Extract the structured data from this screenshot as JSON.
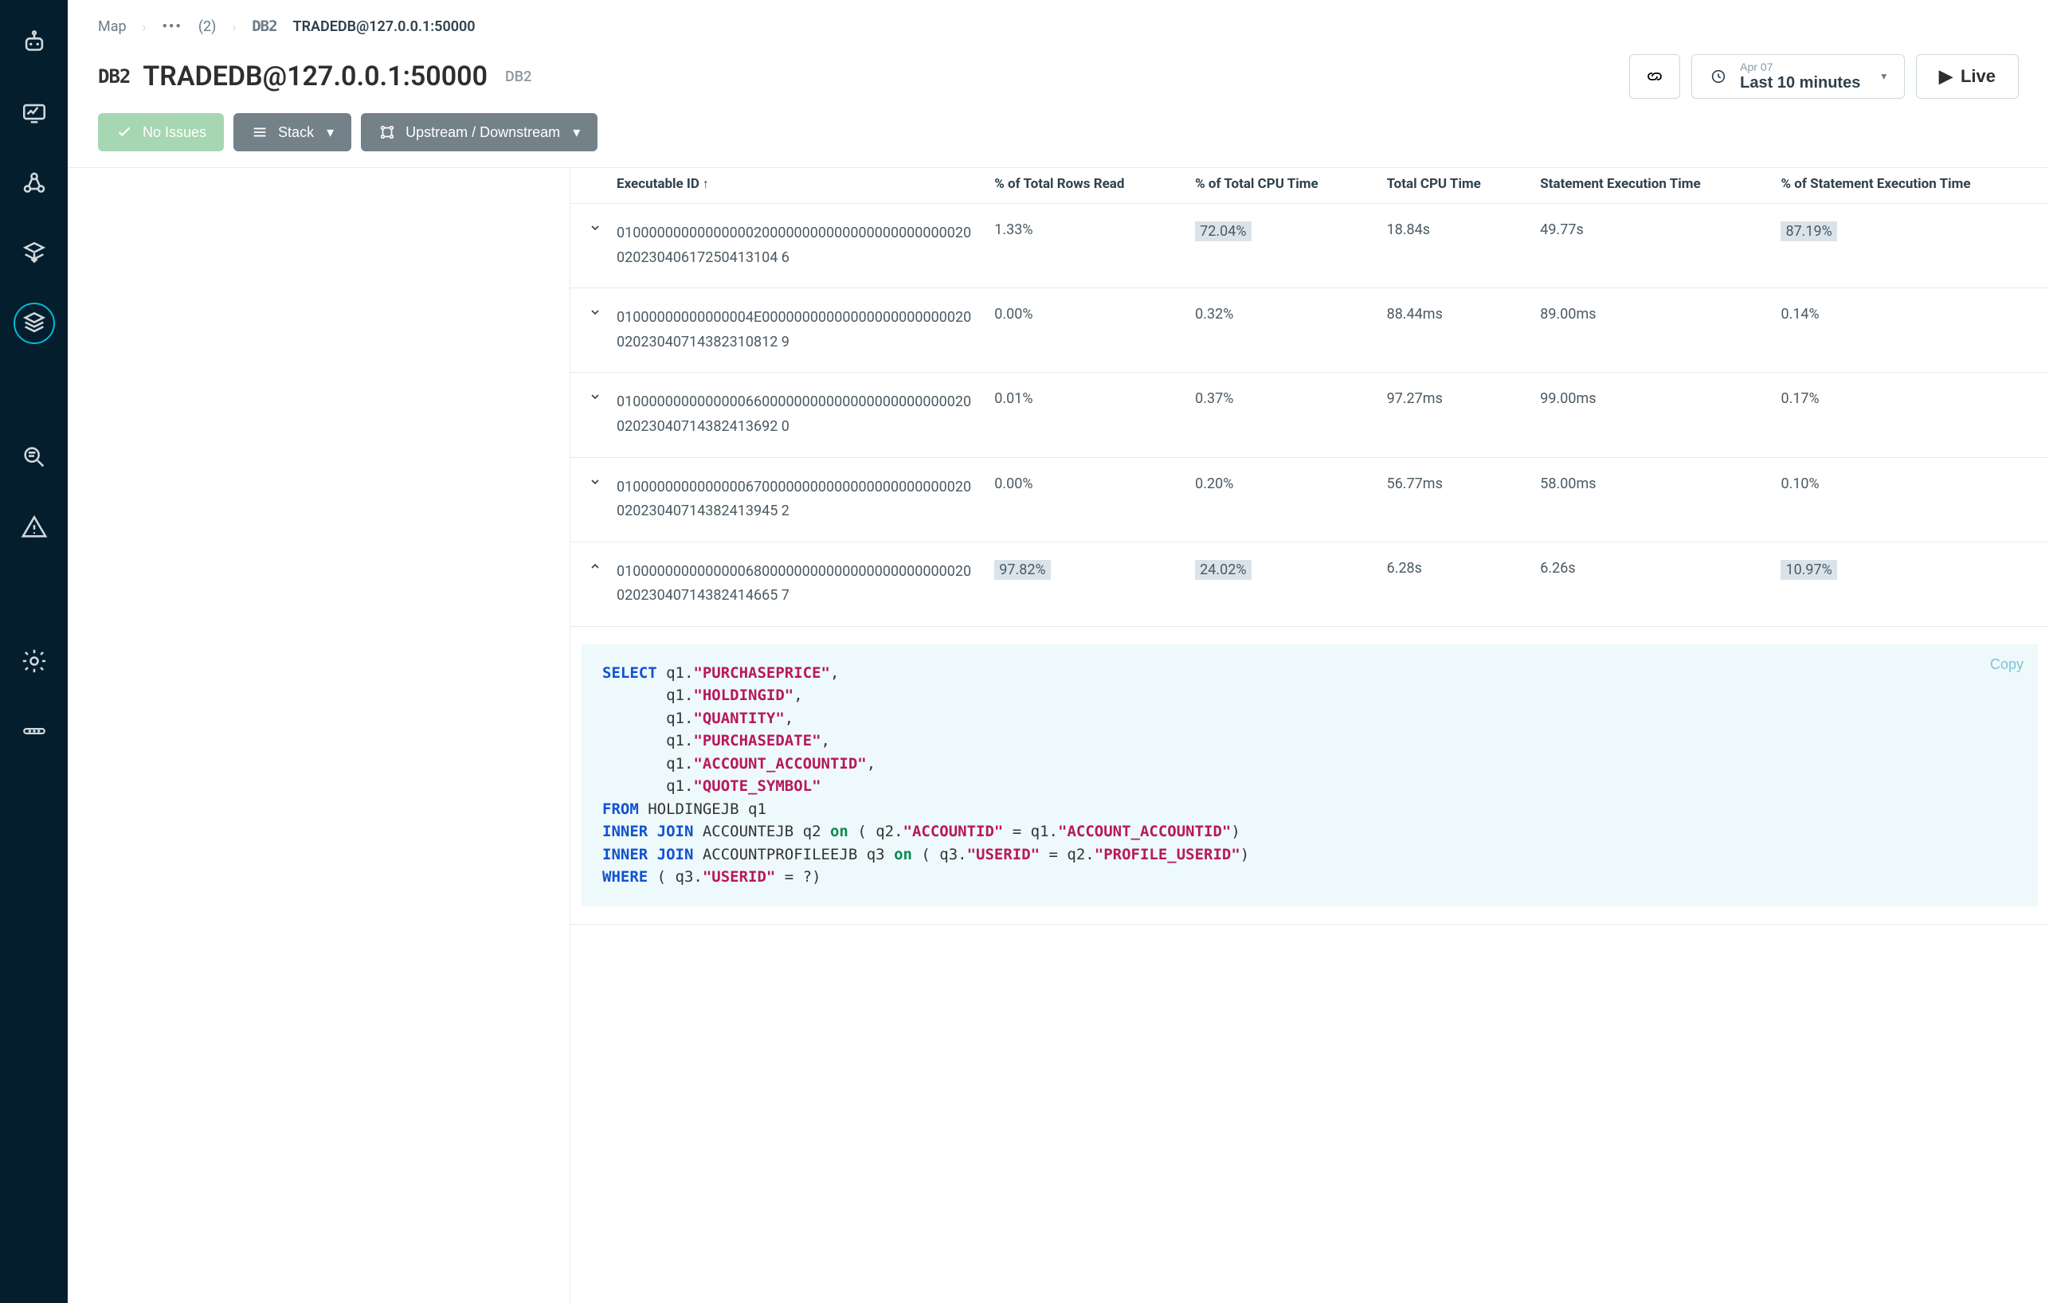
{
  "breadcrumbs": {
    "root": "Map",
    "mid_count": "(2)",
    "db_icon": "DB2",
    "title": "TRADEDB@127.0.0.1:50000"
  },
  "header": {
    "db_badge": "DB2",
    "title": "TRADEDB@127.0.0.1:50000",
    "db_type": "DB2",
    "time_small": "Apr 07",
    "time_big": "Last 10 minutes",
    "live": "Live"
  },
  "toolbar": {
    "noissues": "No Issues",
    "stack": "Stack",
    "updown": "Upstream / Downstream"
  },
  "table": {
    "headers": {
      "execid": "Executable ID",
      "rows": "% of Total Rows Read",
      "cpu_pct": "% of Total CPU Time",
      "cpu_time": "Total CPU Time",
      "stmt_time": "Statement Execution Time",
      "stmt_pct": "% of Statement Execution Time"
    },
    "rows": [
      {
        "expanded": false,
        "execid": "0100000000000000020000000000000000000000002002023040617250413104 6",
        "rows": "1.33%",
        "cpu_pct": "72.04%",
        "cpu_pct_hl": true,
        "cpu_time": "18.84s",
        "stmt_time": "49.77s",
        "stmt_pct": "87.19%",
        "stmt_pct_hl": true
      },
      {
        "expanded": false,
        "execid": "01000000000000004E0000000000000000000000002002023040714382310812 9",
        "rows": "0.00%",
        "cpu_pct": "0.32%",
        "cpu_time": "88.44ms",
        "stmt_time": "89.00ms",
        "stmt_pct": "0.14%"
      },
      {
        "expanded": false,
        "execid": "0100000000000000660000000000000000000000002002023040714382413692 0",
        "rows": "0.01%",
        "cpu_pct": "0.37%",
        "cpu_time": "97.27ms",
        "stmt_time": "99.00ms",
        "stmt_pct": "0.17%"
      },
      {
        "expanded": false,
        "execid": "0100000000000000670000000000000000000000002002023040714382413945 2",
        "rows": "0.00%",
        "cpu_pct": "0.20%",
        "cpu_time": "56.77ms",
        "stmt_time": "58.00ms",
        "stmt_pct": "0.10%"
      },
      {
        "expanded": true,
        "execid": "0100000000000000680000000000000000000000002002023040714382414665 7",
        "rows": "97.82%",
        "rows_hl": true,
        "cpu_pct": "24.02%",
        "cpu_pct_hl": true,
        "cpu_time": "6.28s",
        "stmt_time": "6.26s",
        "stmt_pct": "10.97%",
        "stmt_pct_hl": true
      }
    ]
  },
  "sql": {
    "copy": "Copy",
    "tokens": [
      [
        "kw",
        "SELECT"
      ],
      [
        "txt",
        " q1."
      ],
      [
        "str",
        "\"PURCHASEPRICE\""
      ],
      [
        "txt",
        ",\n       q1."
      ],
      [
        "str",
        "\"HOLDINGID\""
      ],
      [
        "txt",
        ",\n       q1."
      ],
      [
        "str",
        "\"QUANTITY\""
      ],
      [
        "txt",
        ",\n       q1."
      ],
      [
        "str",
        "\"PURCHASEDATE\""
      ],
      [
        "txt",
        ",\n       q1."
      ],
      [
        "str",
        "\"ACCOUNT_ACCOUNTID\""
      ],
      [
        "txt",
        ",\n       q1."
      ],
      [
        "str",
        "\"QUOTE_SYMBOL\""
      ],
      [
        "txt",
        "\n"
      ],
      [
        "kw",
        "FROM"
      ],
      [
        "txt",
        " HOLDINGEJB q1\n"
      ],
      [
        "kw",
        "INNER JOIN"
      ],
      [
        "txt",
        " ACCOUNTEJB q2 "
      ],
      [
        "on",
        "on"
      ],
      [
        "txt",
        " ( q2."
      ],
      [
        "str",
        "\"ACCOUNTID\""
      ],
      [
        "txt",
        " = q1."
      ],
      [
        "str",
        "\"ACCOUNT_ACCOUNTID\""
      ],
      [
        "txt",
        ")\n"
      ],
      [
        "kw",
        "INNER JOIN"
      ],
      [
        "txt",
        " ACCOUNTPROFILEEJB q3 "
      ],
      [
        "on",
        "on"
      ],
      [
        "txt",
        " ( q3."
      ],
      [
        "str",
        "\"USERID\""
      ],
      [
        "txt",
        " = q2."
      ],
      [
        "str",
        "\"PROFILE_USERID\""
      ],
      [
        "txt",
        ")\n"
      ],
      [
        "kw",
        "WHERE"
      ],
      [
        "txt",
        " ( q3."
      ],
      [
        "str",
        "\"USERID\""
      ],
      [
        "txt",
        " = ?)"
      ]
    ]
  }
}
